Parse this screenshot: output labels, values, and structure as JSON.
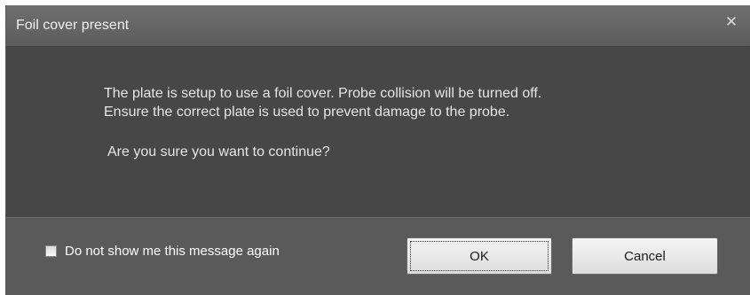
{
  "dialog": {
    "title": "Foil cover present",
    "close_icon": "close-icon",
    "message": {
      "line1": "The plate is setup to use a foil cover. Probe collision will be turned off.",
      "line2": "Ensure the correct plate is used to prevent damage to the probe.",
      "question": "Are you sure you want to continue?"
    },
    "footer": {
      "checkbox_label": "Do not show me this message again",
      "checkbox_checked": false,
      "ok_label": "OK",
      "cancel_label": "Cancel"
    }
  }
}
